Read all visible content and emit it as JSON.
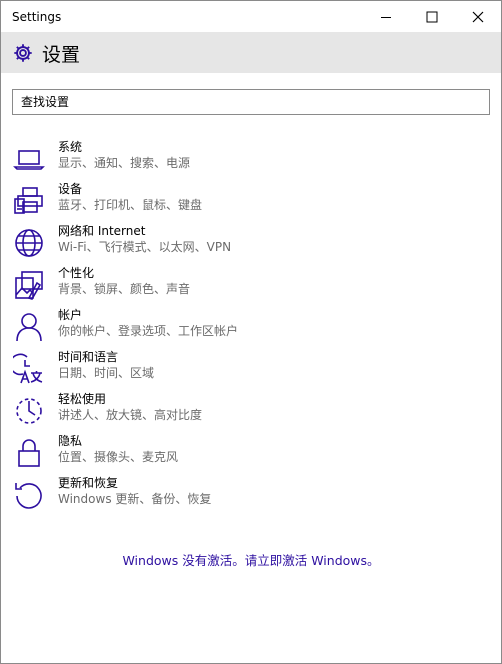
{
  "window": {
    "title": "Settings"
  },
  "header": {
    "title": "设置"
  },
  "search": {
    "placeholder": "查找设置"
  },
  "categories": [
    {
      "label": "系统",
      "description": "显示、通知、搜索、电源",
      "icon": "laptop-icon"
    },
    {
      "label": "设备",
      "description": "蓝牙、打印机、鼠标、键盘",
      "icon": "printer-icon"
    },
    {
      "label": "网络和 Internet",
      "description": "Wi-Fi、飞行模式、以太网、VPN",
      "icon": "globe-icon"
    },
    {
      "label": "个性化",
      "description": "背景、锁屏、颜色、声音",
      "icon": "personalization-icon"
    },
    {
      "label": "帐户",
      "description": "你的帐户、登录选项、工作区帐户",
      "icon": "person-icon"
    },
    {
      "label": "时间和语言",
      "description": "日期、时间、区域",
      "icon": "time-language-icon"
    },
    {
      "label": "轻松使用",
      "description": "讲述人、放大镜、高对比度",
      "icon": "ease-of-access-icon"
    },
    {
      "label": "隐私",
      "description": "位置、摄像头、麦克风",
      "icon": "lock-icon"
    },
    {
      "label": "更新和恢复",
      "description": "Windows 更新、备份、恢复",
      "icon": "update-icon"
    }
  ],
  "activation": {
    "link_text": "Windows 没有激活。请立即激活 Windows。"
  },
  "colors": {
    "accent": "#2d0fa0",
    "header_bg": "#e6e6e6",
    "secondary_text": "#6b6b6b"
  }
}
